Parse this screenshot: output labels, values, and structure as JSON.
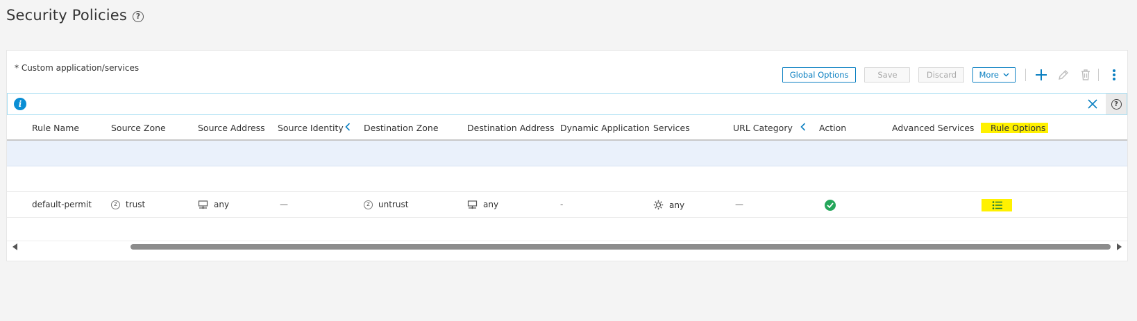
{
  "page": {
    "title": "Security Policies"
  },
  "panel": {
    "note": "* Custom application/services"
  },
  "toolbar": {
    "global_options": "Global Options",
    "save": "Save",
    "discard": "Discard",
    "more": "More",
    "icons": [
      "plus-icon",
      "pencil-icon",
      "trash-icon",
      "kebab-menu-icon"
    ]
  },
  "info_bar": {
    "icons": [
      "info-icon",
      "close-icon",
      "help-icon"
    ]
  },
  "table": {
    "columns": [
      "Rule Name",
      "Source Zone",
      "Source Address",
      "Source Identity",
      "Destination Zone",
      "Destination Address",
      "Dynamic Application",
      "Services",
      "URL Category",
      "Action",
      "Advanced Services",
      "Rule Options"
    ],
    "rows": [
      {
        "rule_name": "default-permit",
        "source_zone": "trust",
        "source_address": "any",
        "source_identity": "—",
        "destination_zone": "untrust",
        "destination_address": "any",
        "dynamic_application": "-",
        "services": "any",
        "url_category": "—",
        "action": "permit",
        "advanced_services": "",
        "rule_options": "list-icon"
      }
    ]
  },
  "colors": {
    "accent": "#0a7fc1",
    "highlight": "#fff100",
    "success": "#24a65a",
    "selected_row": "#eaf1fb"
  }
}
